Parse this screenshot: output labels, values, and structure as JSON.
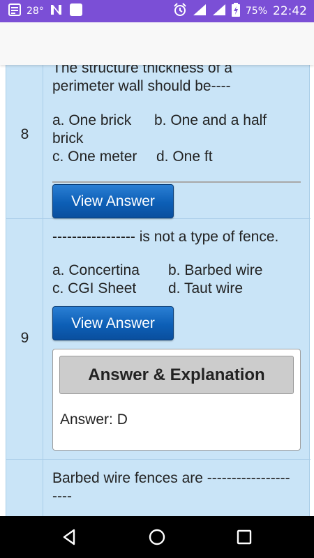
{
  "status_bar": {
    "temperature": "28°",
    "battery_percent": "75%",
    "time": "22:42",
    "icons": [
      "notes-icon",
      "news-n-icon",
      "blank-square-icon",
      "alarm-icon",
      "signal-icon",
      "signal-icon-2",
      "battery-charging-icon"
    ]
  },
  "questions": [
    {
      "number": "8",
      "lines": [
        "The structure thickness of a",
        "perimeter wall should be----"
      ],
      "options_line1": [
        "a. One brick",
        "b. One and a half"
      ],
      "options_line2_wrap": "brick",
      "options_line3": [
        "c. One meter",
        "d. One ft"
      ],
      "button": "View Answer"
    },
    {
      "number": "9",
      "lines": [
        "----------------- is not a type of fence."
      ],
      "options_line1": [
        "a. Concertina",
        "b. Barbed wire"
      ],
      "options_line2": [
        "c. CGI Sheet",
        "d. Taut wire"
      ],
      "button": "View Answer",
      "answer_header": "Answer & Explanation",
      "answer_text": "Answer: D"
    },
    {
      "lines": [
        "Barbed wire fences are  -----------------",
        "----"
      ]
    }
  ],
  "colors": {
    "status_bar": "#7b4fd6",
    "table_bg": "#c9e4f7",
    "button_blue": "#0d5fb6",
    "answer_header_bg": "#cccccc"
  }
}
